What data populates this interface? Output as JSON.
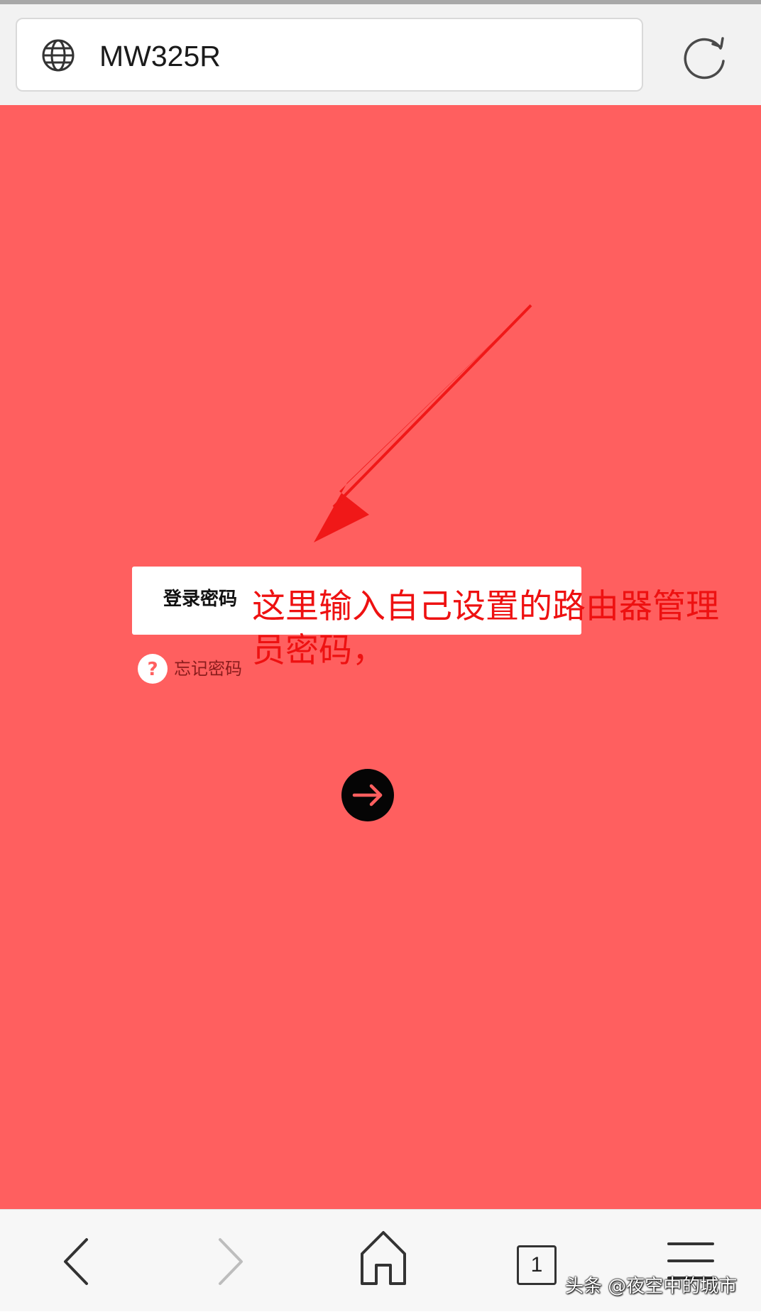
{
  "browser": {
    "url": "MW325R",
    "tab_count": "1"
  },
  "login": {
    "password_label": "登录密码",
    "forgot_password": "忘记密码"
  },
  "annotation": {
    "text": "这里输入自己设置的路由器管理员密码，"
  },
  "watermark": "头条 @夜空中的城市",
  "colors": {
    "page_background": "#ff5f5f",
    "annotation_red": "#ee1111",
    "toolbar_background": "#f7f7f7"
  },
  "icons": {
    "address": "globe-icon",
    "reload": "refresh-icon",
    "submit": "arrow-right-icon",
    "back": "chevron-left-icon",
    "forward": "chevron-right-icon",
    "home": "home-icon",
    "menu": "menu-icon"
  }
}
